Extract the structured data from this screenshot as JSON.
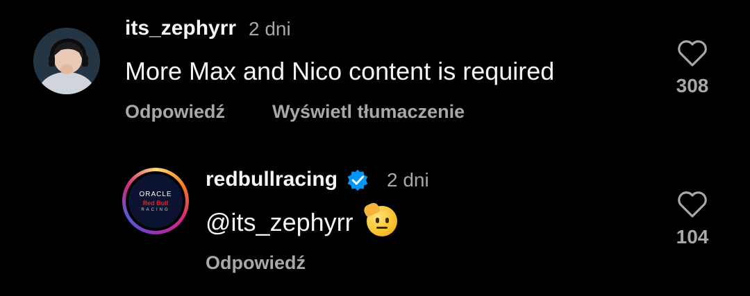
{
  "comments": [
    {
      "username": "its_zephyrr",
      "time": "2 dni",
      "text": "More Max and Nico content is required",
      "actions": {
        "reply": "Odpowiedź",
        "translate": "Wyświetl tłumaczenie"
      },
      "likes": "308",
      "avatar_icon": "user-avatar-headset"
    },
    {
      "username": "redbullracing",
      "verified": true,
      "time": "2 dni",
      "text": "@its_zephyrr",
      "emoji": "saluting-face",
      "actions": {
        "reply": "Odpowiedź"
      },
      "likes": "104",
      "avatar_logo": {
        "line1": "ORACLE",
        "line2": "Red Bull",
        "line3": "RACING"
      }
    }
  ],
  "colors": {
    "background": "#000000",
    "primary_text": "#f5f5f5",
    "secondary_text": "#a8a8a8",
    "verified_blue": "#0095f6"
  }
}
